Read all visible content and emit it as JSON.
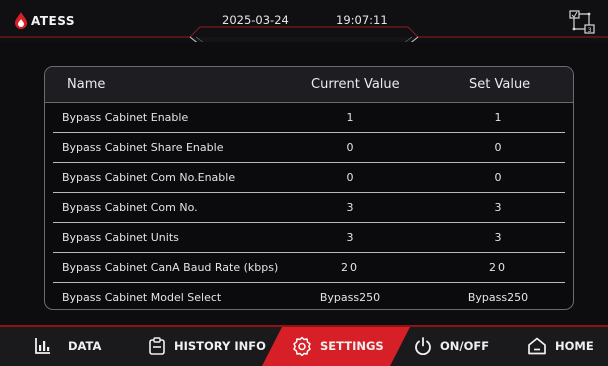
{
  "header": {
    "brand": "ATESS",
    "date": "2025-03-24",
    "time": "19:07:11"
  },
  "table": {
    "columns": {
      "name": "Name",
      "current": "Current Value",
      "set": "Set Value"
    },
    "rows": [
      {
        "name": "Bypass Cabinet Enable",
        "current": "1",
        "set": "1"
      },
      {
        "name": "Bypass Cabinet Share Enable",
        "current": "0",
        "set": "0"
      },
      {
        "name": "Bypass Cabinet Com No.Enable",
        "current": "0",
        "set": "0"
      },
      {
        "name": "Bypass Cabinet Com No.",
        "current": "3",
        "set": "3"
      },
      {
        "name": "Bypass Cabinet Units",
        "current": "3",
        "set": "3"
      },
      {
        "name": "Bypass Cabinet CanA Baud Rate (kbps)",
        "current": "20",
        "set": "20"
      },
      {
        "name": "Bypass Cabinet Model Select",
        "current": "Bypass250",
        "set": "Bypass250"
      }
    ]
  },
  "nav": {
    "data": "DATA",
    "history": "HISTORY INFO",
    "settings": "SETTINGS",
    "onoff": "ON/OFF",
    "home": "HOME",
    "active": "settings",
    "accent": "#d61f26"
  }
}
